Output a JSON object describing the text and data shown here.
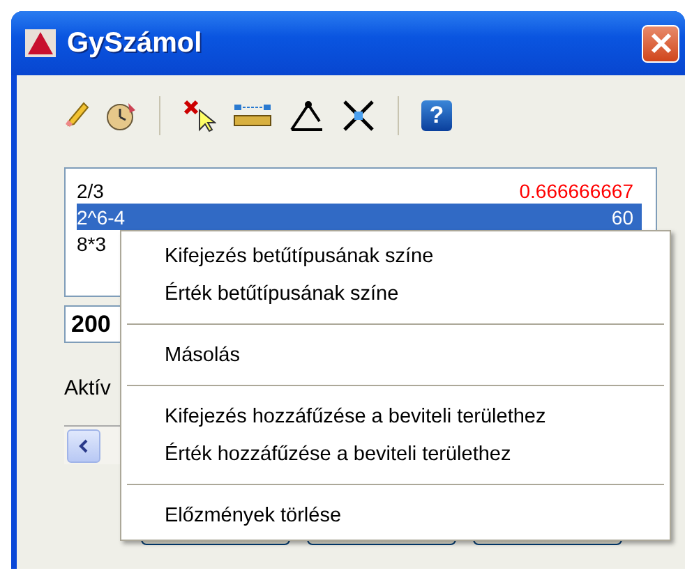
{
  "window": {
    "title": "GySzámol"
  },
  "toolbar": [
    {
      "kind": "eraser"
    },
    {
      "kind": "clock"
    },
    {
      "kind": "separator"
    },
    {
      "kind": "delete-select"
    },
    {
      "kind": "ruler"
    },
    {
      "kind": "angle"
    },
    {
      "kind": "intersection"
    },
    {
      "kind": "separator"
    },
    {
      "kind": "help",
      "label": "?"
    }
  ],
  "history": [
    {
      "expression": "2/3",
      "value": "0.666666667",
      "selected": false,
      "color": "#ff0000"
    },
    {
      "expression": "2^6-4",
      "value": "60",
      "selected": true
    },
    {
      "expression": "8*3",
      "selected": false
    }
  ],
  "input": {
    "value": "200"
  },
  "status_label": "Aktív",
  "buttons": [
    {
      "kind": "push"
    },
    {
      "kind": "push"
    },
    {
      "kind": "push"
    }
  ],
  "context_menu": [
    {
      "kind": "item",
      "label": "Kifejezés betűtípusának színe"
    },
    {
      "kind": "item",
      "label": "Érték betűtípusának színe"
    },
    {
      "kind": "separator"
    },
    {
      "kind": "item",
      "label": "Másolás"
    },
    {
      "kind": "separator"
    },
    {
      "kind": "item",
      "label": "Kifejezés hozzáfűzése a beviteli területhez"
    },
    {
      "kind": "item",
      "label": "Érték hozzáfűzése a beviteli területhez"
    },
    {
      "kind": "separator"
    },
    {
      "kind": "item",
      "label": "Előzmények törlése"
    }
  ]
}
